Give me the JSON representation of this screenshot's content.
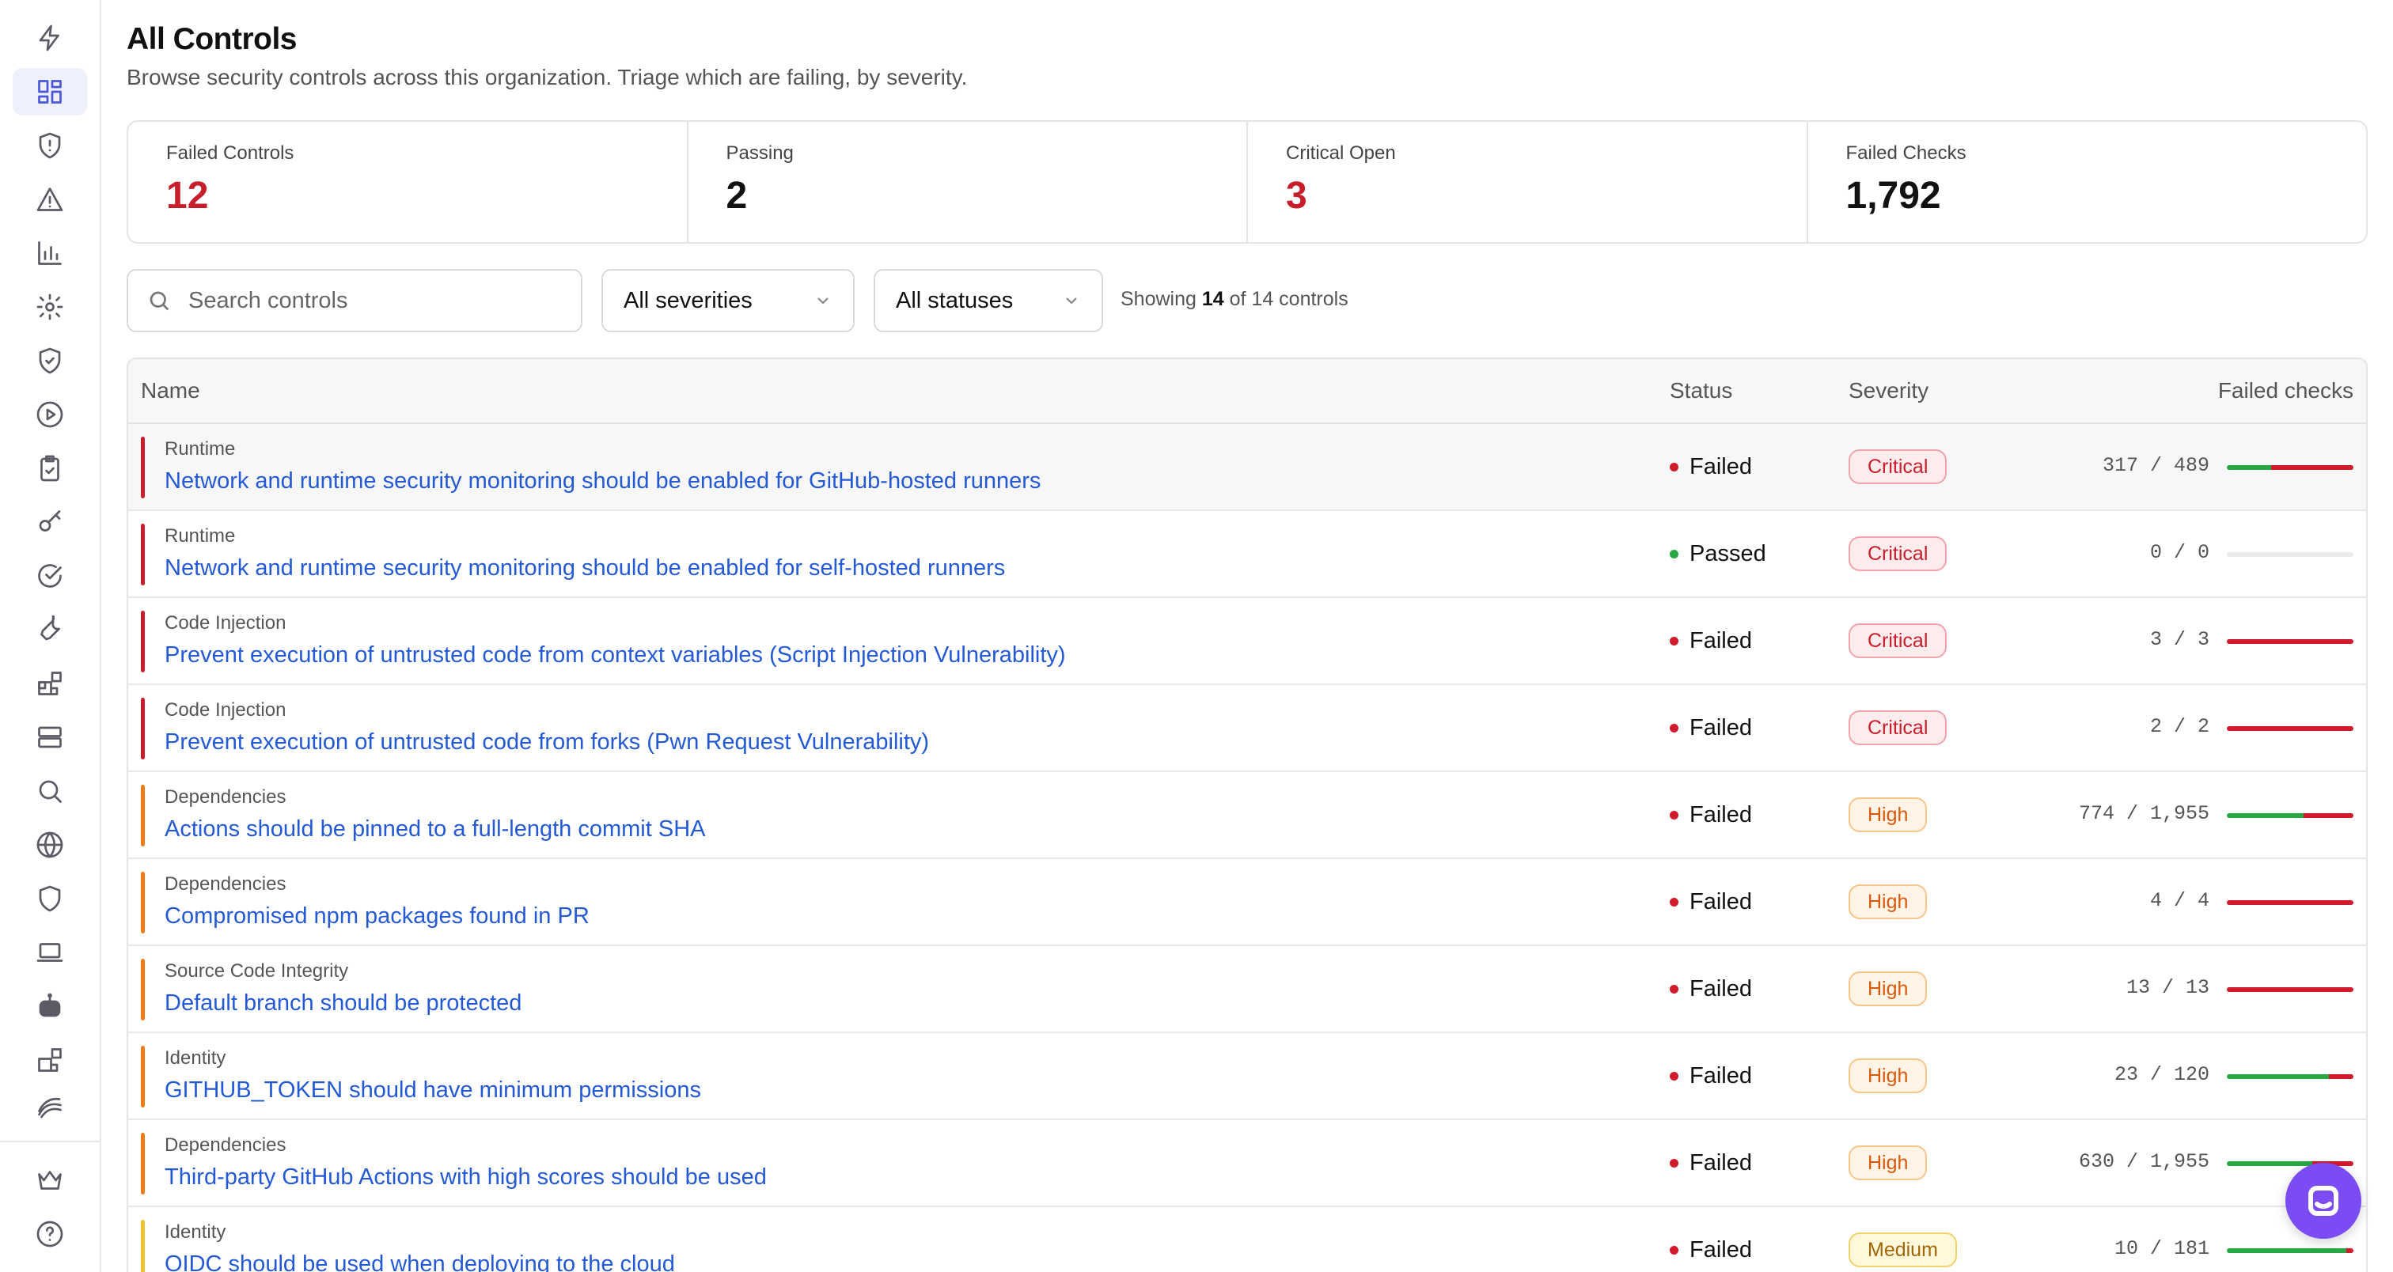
{
  "header": {
    "title": "All Controls",
    "subtitle": "Browse security controls across this organization. Triage which are failing, by severity."
  },
  "stats": [
    {
      "label": "Failed Controls",
      "value": "12",
      "color": "#c81e2c"
    },
    {
      "label": "Passing",
      "value": "2",
      "color": "#111111"
    },
    {
      "label": "Critical Open",
      "value": "3",
      "color": "#c81e2c"
    },
    {
      "label": "Failed Checks",
      "value": "1,792",
      "color": "#111111"
    }
  ],
  "filters": {
    "search_placeholder": "Search controls",
    "severity": "All severities",
    "status": "All statuses",
    "showing_prefix": "Showing",
    "showing_count": "14",
    "showing_suffix": "of 14 controls"
  },
  "table": {
    "columns": {
      "name": "Name",
      "status": "Status",
      "severity": "Severity",
      "failed_checks": "Failed checks"
    },
    "rows": [
      {
        "category": "Runtime",
        "name": "Network and runtime security monitoring should be enabled for GitHub-hosted runners",
        "status": "Failed",
        "severity": "Critical",
        "checks": "317 / 489",
        "pass_fraction": 0.352
      },
      {
        "category": "Runtime",
        "name": "Network and runtime security monitoring should be enabled for self-hosted runners",
        "status": "Passed",
        "severity": "Critical",
        "checks": "0 / 0",
        "pass_fraction": 0
      },
      {
        "category": "Code Injection",
        "name": "Prevent execution of untrusted code from context variables (Script Injection Vulnerability)",
        "status": "Failed",
        "severity": "Critical",
        "checks": "3 / 3",
        "pass_fraction": 0
      },
      {
        "category": "Code Injection",
        "name": "Prevent execution of untrusted code from forks (Pwn Request Vulnerability)",
        "status": "Failed",
        "severity": "Critical",
        "checks": "2 / 2",
        "pass_fraction": 0
      },
      {
        "category": "Dependencies",
        "name": "Actions should be pinned to a full-length commit SHA",
        "status": "Failed",
        "severity": "High",
        "checks": "774 / 1,955",
        "pass_fraction": 0.604
      },
      {
        "category": "Dependencies",
        "name": "Compromised npm packages found in PR",
        "status": "Failed",
        "severity": "High",
        "checks": "4 / 4",
        "pass_fraction": 0
      },
      {
        "category": "Source Code Integrity",
        "name": "Default branch should be protected",
        "status": "Failed",
        "severity": "High",
        "checks": "13 / 13",
        "pass_fraction": 0
      },
      {
        "category": "Identity",
        "name": "GITHUB_TOKEN should have minimum permissions",
        "status": "Failed",
        "severity": "High",
        "checks": "23 / 120",
        "pass_fraction": 0.808
      },
      {
        "category": "Dependencies",
        "name": "Third-party GitHub Actions with high scores should be used",
        "status": "Failed",
        "severity": "High",
        "checks": "630 / 1,955",
        "pass_fraction": 0.678
      },
      {
        "category": "Identity",
        "name": "OIDC should be used when deploying to the cloud",
        "status": "Failed",
        "severity": "Medium",
        "checks": "10 / 181",
        "pass_fraction": 0.945
      }
    ]
  },
  "colors": {
    "critical": "#c81e2c",
    "high": "#f07a16",
    "medium": "#f2c230",
    "failed_dot": "#d11a2a",
    "passed_dot": "#28a745",
    "link": "#2459d6",
    "accent": "#4a57d6"
  },
  "sidebar": {
    "icons": [
      "bolt-icon",
      "dashboard-icon",
      "shield-alert-icon",
      "warning-icon",
      "chart-icon",
      "gear-icon",
      "shield-check-icon",
      "play-icon",
      "clipboard-icon",
      "key-icon",
      "check-circle-icon",
      "wrench-icon",
      "blocks-icon",
      "server-icon",
      "search-icon",
      "globe-icon",
      "shield-icon",
      "laptop-icon",
      "bot-icon",
      "blocks-icon-2",
      "wave-icon",
      "crown-icon",
      "help-icon"
    ]
  }
}
